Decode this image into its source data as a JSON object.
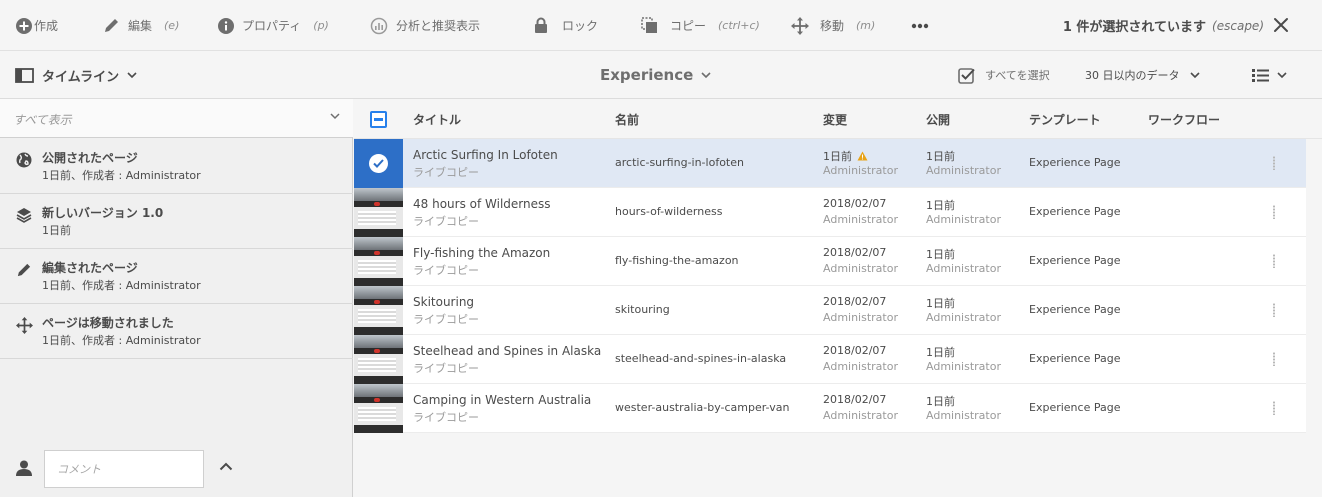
{
  "actionbar": {
    "create": "作成",
    "edit": "編集",
    "edit_hint": "(e)",
    "properties": "プロパティ",
    "properties_hint": "(p)",
    "analytics": "分析と推奨表示",
    "lock": "ロック",
    "copy": "コピー",
    "copy_hint": "(ctrl+c)",
    "move": "移動",
    "move_hint": "(m)",
    "selection_text": "1 件が選択されています",
    "selection_hint": "(escape)"
  },
  "secondbar": {
    "rail_label": "タイムライン",
    "breadcrumb": "Experience",
    "select_all": "すべてを選択",
    "date_filter": "30 日以内のデータ"
  },
  "rail": {
    "filter": "すべて表示",
    "items": [
      {
        "icon": "globe-icon",
        "title": "公開されたページ",
        "sub": "1日前、作成者 : Administrator"
      },
      {
        "icon": "layers-icon",
        "title": "新しいバージョン 1.0",
        "sub": "1日前"
      },
      {
        "icon": "pencil-icon",
        "title": "編集されたページ",
        "sub": "1日前、作成者 : Administrator"
      },
      {
        "icon": "move-icon",
        "title": "ページは移動されました",
        "sub": "1日前、作成者 : Administrator"
      }
    ],
    "comment_placeholder": "コメント"
  },
  "table": {
    "headers": {
      "title": "タイトル",
      "name": "名前",
      "modified": "変更",
      "published": "公開",
      "template": "テンプレート",
      "workflow": "ワークフロー"
    },
    "rows": [
      {
        "title": "Arctic Surfing In Lofoten",
        "type": "ライブコピー",
        "name": "arctic-surfing-in-lofoten",
        "modified": "1日前",
        "modified_by": "Administrator",
        "published": "1日前",
        "published_by": "Administrator",
        "template": "Experience Page",
        "selected": true,
        "warning": true
      },
      {
        "title": "48 hours of Wilderness",
        "type": "ライブコピー",
        "name": "hours-of-wilderness",
        "modified": "2018/02/07",
        "modified_by": "Administrator",
        "published": "1日前",
        "published_by": "Administrator",
        "template": "Experience Page",
        "selected": false,
        "warning": false
      },
      {
        "title": "Fly-fishing the Amazon",
        "type": "ライブコピー",
        "name": "fly-fishing-the-amazon",
        "modified": "2018/02/07",
        "modified_by": "Administrator",
        "published": "1日前",
        "published_by": "Administrator",
        "template": "Experience Page",
        "selected": false,
        "warning": false
      },
      {
        "title": "Skitouring",
        "type": "ライブコピー",
        "name": "skitouring",
        "modified": "2018/02/07",
        "modified_by": "Administrator",
        "published": "1日前",
        "published_by": "Administrator",
        "template": "Experience Page",
        "selected": false,
        "warning": false
      },
      {
        "title": "Steelhead and Spines in Alaska",
        "type": "ライブコピー",
        "name": "steelhead-and-spines-in-alaska",
        "modified": "2018/02/07",
        "modified_by": "Administrator",
        "published": "1日前",
        "published_by": "Administrator",
        "template": "Experience Page",
        "selected": false,
        "warning": false
      },
      {
        "title": "Camping in Western Australia",
        "type": "ライブコピー",
        "name": "wester-australia-by-camper-van",
        "modified": "2018/02/07",
        "modified_by": "Administrator",
        "published": "1日前",
        "published_by": "Administrator",
        "template": "Experience Page",
        "selected": false,
        "warning": false
      }
    ]
  },
  "colors": {
    "accent": "#2680eb",
    "selected_row": "#e0e8f4",
    "selected_check": "#2d6fc7",
    "warning": "#e8a317"
  }
}
